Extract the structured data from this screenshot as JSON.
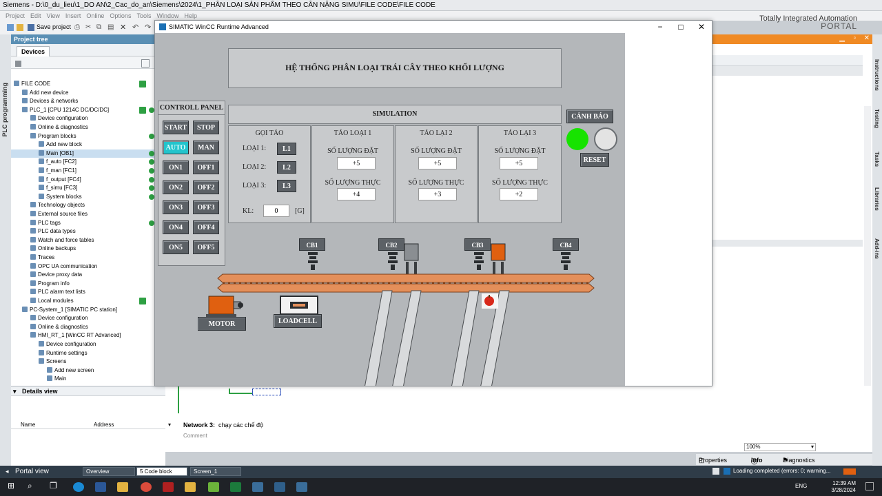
{
  "tia": {
    "title": "Siemens  -  D:\\0_du_lieu\\1_DO AN\\2_Cac_do_an\\Siemens\\2024\\1_PHÂN LOẠI SẢN PHẨM THEO CÂN NẶNG SIMU\\FILE CODE\\FILE CODE",
    "menu": [
      "Project",
      "Edit",
      "View",
      "Insert",
      "Online",
      "Options",
      "Tools",
      "Window",
      "Help"
    ],
    "save_project": "Save project",
    "brand_line1": "Totally Integrated Automation",
    "brand_line2": "PORTAL",
    "left_strip": "PLC programming",
    "project_tree_title": "Project tree",
    "devices_tab": "Devices",
    "tree": [
      {
        "label": "FILE CODE",
        "indent": 0,
        "check": true
      },
      {
        "label": "Add new device",
        "indent": 1
      },
      {
        "label": "Devices & networks",
        "indent": 1
      },
      {
        "label": "PLC_1 [CPU 1214C DC/DC/DC]",
        "indent": 1,
        "check": true,
        "dot": true
      },
      {
        "label": "Device configuration",
        "indent": 2
      },
      {
        "label": "Online & diagnostics",
        "indent": 2
      },
      {
        "label": "Program blocks",
        "indent": 2,
        "dot": true
      },
      {
        "label": "Add new block",
        "indent": 3
      },
      {
        "label": "Main [OB1]",
        "indent": 3,
        "dot": true,
        "selected": true
      },
      {
        "label": "f_auto [FC2]",
        "indent": 3,
        "dot": true
      },
      {
        "label": "f_man [FC1]",
        "indent": 3,
        "dot": true
      },
      {
        "label": "f_output [FC4]",
        "indent": 3,
        "dot": true
      },
      {
        "label": "f_simu [FC3]",
        "indent": 3,
        "dot": true
      },
      {
        "label": "System blocks",
        "indent": 3,
        "dot": true
      },
      {
        "label": "Technology objects",
        "indent": 2
      },
      {
        "label": "External source files",
        "indent": 2
      },
      {
        "label": "PLC tags",
        "indent": 2,
        "dot": true
      },
      {
        "label": "PLC data types",
        "indent": 2
      },
      {
        "label": "Watch and force tables",
        "indent": 2
      },
      {
        "label": "Online backups",
        "indent": 2
      },
      {
        "label": "Traces",
        "indent": 2
      },
      {
        "label": "OPC UA communication",
        "indent": 2
      },
      {
        "label": "Device proxy data",
        "indent": 2
      },
      {
        "label": "Program info",
        "indent": 2
      },
      {
        "label": "PLC alarm text lists",
        "indent": 2
      },
      {
        "label": "Local modules",
        "indent": 2,
        "check": true
      },
      {
        "label": "PC-System_1 [SIMATIC PC station]",
        "indent": 1
      },
      {
        "label": "Device configuration",
        "indent": 2
      },
      {
        "label": "Online & diagnostics",
        "indent": 2
      },
      {
        "label": "HMI_RT_1 [WinCC RT Advanced]",
        "indent": 2
      },
      {
        "label": "Device configuration",
        "indent": 3
      },
      {
        "label": "Runtime settings",
        "indent": 3
      },
      {
        "label": "Screens",
        "indent": 3
      },
      {
        "label": "Add new screen",
        "indent": 4
      },
      {
        "label": "Main",
        "indent": 4
      }
    ],
    "details_view": "Details view",
    "details_cols": [
      "Name",
      "Address"
    ],
    "network_label": "Network 3:",
    "network_desc": "chạy các chế độ",
    "comment": "Comment",
    "zoom": "100%",
    "inspector_tabs": [
      "Properties",
      "Info",
      "Diagnostics"
    ],
    "right_tabs": [
      "Instructions",
      "Testing",
      "Tasks",
      "Libraries",
      "Add-ins"
    ],
    "portal_view": "Portal view",
    "editor_tabs": [
      "Overview",
      "5 Code block",
      "Screen_1"
    ],
    "status_msg": "Loading completed (errors: 0; warning...",
    "clock_time": "12:39 AM",
    "clock_date": "3/28/2024",
    "lang": "ENG"
  },
  "wincc": {
    "window_title": "SIMATIC WinCC Runtime Advanced",
    "hmi_title": "HỆ THỐNG PHÂN LOẠI TRÁI CÂY THEO KHỐI LƯỢNG",
    "control_panel": "CONTROLL PANEL",
    "buttons": {
      "start": "START",
      "stop": "STOP",
      "auto": "AUTO",
      "man": "MAN",
      "on1": "ON1",
      "off1": "OFF1",
      "on2": "ON2",
      "off2": "OFF2",
      "on3": "ON3",
      "off3": "OFF3",
      "on4": "ON4",
      "off4": "OFF4",
      "on5": "ON5",
      "off5": "OFF5"
    },
    "simulation": "SIMULATION",
    "goi_tao": "GỌI TÁO",
    "loai1": "LOẠI 1:",
    "loai2": "LOẠI 2:",
    "loai3": "LOẠI 3:",
    "l1": "L1",
    "l2": "L2",
    "l3": "L3",
    "kl_label": "KL:",
    "kl_value": "0",
    "kl_unit": "[G]",
    "tao_loai": [
      {
        "title": "TÁO LOẠI 1",
        "dat_label": "SỐ LƯỢNG ĐẶT",
        "dat": "+5",
        "thuc_label": "SỐ LƯỢNG THỰC",
        "thuc": "+4"
      },
      {
        "title": "TÁO LẠI 2",
        "dat_label": "SỐ LƯỢNG ĐẶT",
        "dat": "+5",
        "thuc_label": "SỐ LƯỢNG THỰC",
        "thuc": "+3"
      },
      {
        "title": "TÁO LẠI 3",
        "dat_label": "SỐ LƯỢNG ĐẶT",
        "dat": "+5",
        "thuc_label": "SỐ LƯỢNG THỰC",
        "thuc": "+2"
      }
    ],
    "canh_bao": "CẢNH BÁO",
    "reset": "RESET",
    "sensors": [
      "CB1",
      "CB2",
      "CB3",
      "CB4"
    ],
    "motor": "MOTOR",
    "loadcell": "LOADCELL",
    "colors": {
      "lamp_on": "#17e300",
      "lamp_off": "#e3e3e3",
      "auto_active": "#23c4cc",
      "conveyor": "#e48f5a"
    }
  }
}
